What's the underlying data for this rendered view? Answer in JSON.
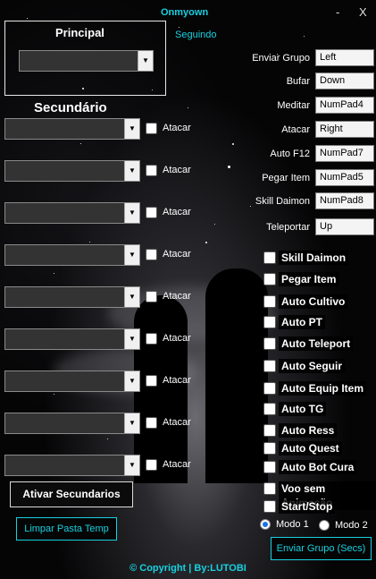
{
  "window": {
    "title": "Onmyown",
    "minimize_glyph": "-",
    "close_glyph": "X",
    "status": "Seguindo"
  },
  "principal": {
    "title": "Principal",
    "selected": ""
  },
  "secundario": {
    "title": "Secundário",
    "check_label": "Atacar",
    "rows": [
      {
        "selected": ""
      },
      {
        "selected": ""
      },
      {
        "selected": ""
      },
      {
        "selected": ""
      },
      {
        "selected": ""
      },
      {
        "selected": ""
      },
      {
        "selected": ""
      },
      {
        "selected": ""
      },
      {
        "selected": ""
      }
    ]
  },
  "hotkeys": [
    {
      "label": "Enviar Grupo",
      "value": "Left"
    },
    {
      "label": "Bufar",
      "value": "Down"
    },
    {
      "label": "Meditar",
      "value": "NumPad4"
    },
    {
      "label": "Atacar",
      "value": "Right"
    },
    {
      "label": "Auto F12",
      "value": "NumPad7"
    },
    {
      "label": "Pegar Item",
      "value": "NumPad5"
    },
    {
      "label": "Skill Daimon",
      "value": "NumPad8"
    },
    {
      "label": "Teleportar",
      "value": "Up"
    }
  ],
  "options": [
    "Skill Daimon",
    "Pegar Item",
    "Auto Cultivo",
    "Auto PT",
    "Auto Teleport",
    "Auto Seguir",
    "Auto Equip Item",
    "Auto TG",
    "Auto Ress",
    "Auto Quest",
    "Auto Bot Cura",
    "Voo sem Animação",
    "Start/Stop"
  ],
  "modes": {
    "mode1": "Modo 1",
    "mode2": "Modo 2",
    "selected": "Modo 1"
  },
  "buttons": {
    "ativar": "Ativar Secundarios",
    "limpar": "Limpar Pasta Temp",
    "enviar_grupo": "Enviar Grupo (Secs)"
  },
  "footer": {
    "copyright": "© Copyright | By:LUTOBI"
  },
  "colors": {
    "accent": "#18d0e0",
    "background": "#050506",
    "radio_selected": "#1a73e8"
  },
  "icons": {
    "combo_arrow": "chevron-down-icon"
  }
}
